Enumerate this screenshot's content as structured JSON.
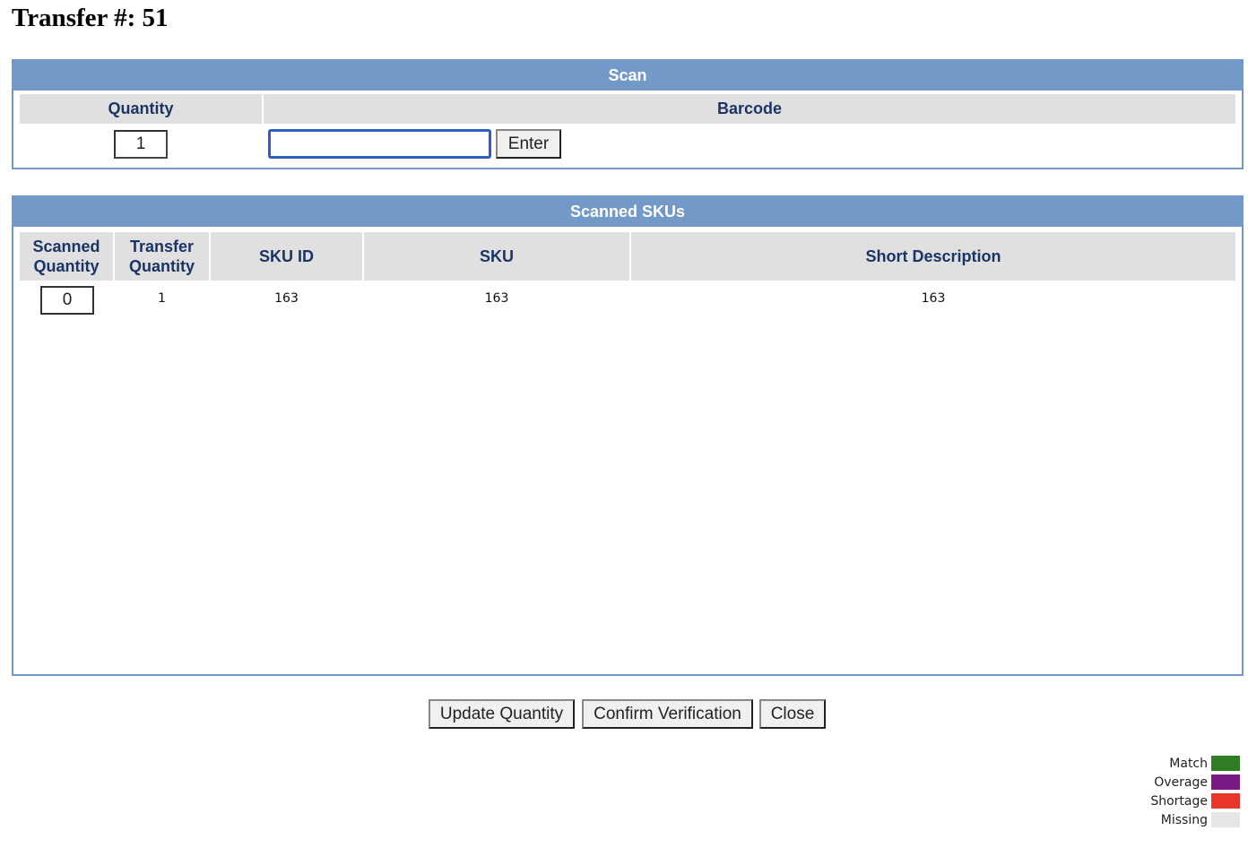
{
  "page": {
    "title": "Transfer #: 51"
  },
  "scan": {
    "header": "Scan",
    "col_quantity": "Quantity",
    "col_barcode": "Barcode",
    "quantity_value": "1",
    "barcode_value": "",
    "enter_label": "Enter"
  },
  "scanned_skus": {
    "header": "Scanned SKUs",
    "columns": {
      "scanned_quantity": "Scanned Quantity",
      "transfer_quantity": "Transfer Quantity",
      "sku_id": "SKU ID",
      "sku": "SKU",
      "short_description": "Short Description"
    },
    "rows": [
      {
        "scanned_quantity": "0",
        "transfer_quantity": "1",
        "sku_id": "163",
        "sku": "163",
        "short_description": "163"
      }
    ]
  },
  "actions": {
    "update_quantity": "Update Quantity",
    "confirm_verification": "Confirm Verification",
    "close": "Close"
  },
  "legend": [
    {
      "label": "Match",
      "color": "#2f7d23"
    },
    {
      "label": "Overage",
      "color": "#7a1a86"
    },
    {
      "label": "Shortage",
      "color": "#e8372a"
    },
    {
      "label": "Missing",
      "color": "#e6e6e6"
    }
  ]
}
